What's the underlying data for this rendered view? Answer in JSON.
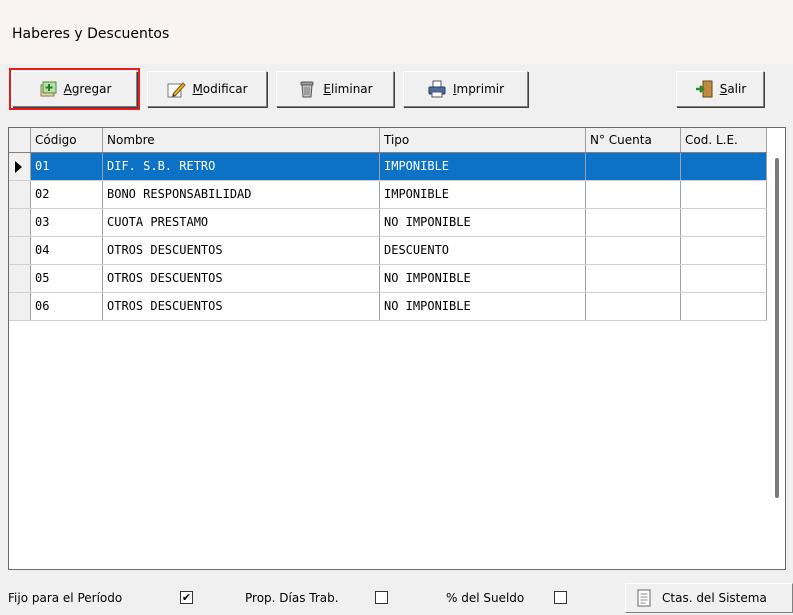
{
  "window": {
    "title": "Haberes y Descuentos"
  },
  "toolbar": {
    "agregar": {
      "pre": "",
      "key": "A",
      "rest": "gregar",
      "icon": "add-record-icon"
    },
    "modificar": {
      "pre": "",
      "key": "M",
      "rest": "odificar",
      "icon": "edit-pencil-icon"
    },
    "eliminar": {
      "pre": "",
      "key": "E",
      "rest": "liminar",
      "icon": "trash-can-icon"
    },
    "imprimir": {
      "pre": "",
      "key": "I",
      "rest": "mprimir",
      "icon": "printer-icon"
    },
    "salir": {
      "pre": "",
      "key": "S",
      "rest": "alir",
      "icon": "exit-door-icon"
    }
  },
  "grid": {
    "columns": [
      "Código",
      "Nombre",
      "Tipo",
      "N° Cuenta",
      "Cod. L.E."
    ],
    "rows": [
      {
        "codigo": "01",
        "nombre": "DIF. S.B. RETRO",
        "tipo": "IMPONIBLE",
        "cuenta": "",
        "codle": ""
      },
      {
        "codigo": "02",
        "nombre": "BONO RESPONSABILIDAD",
        "tipo": "IMPONIBLE",
        "cuenta": "",
        "codle": ""
      },
      {
        "codigo": "03",
        "nombre": "CUOTA PRESTAMO",
        "tipo": "NO IMPONIBLE",
        "cuenta": "",
        "codle": ""
      },
      {
        "codigo": "04",
        "nombre": "OTROS DESCUENTOS",
        "tipo": "DESCUENTO",
        "cuenta": "",
        "codle": ""
      },
      {
        "codigo": "05",
        "nombre": "OTROS DESCUENTOS",
        "tipo": "NO IMPONIBLE",
        "cuenta": "",
        "codle": ""
      },
      {
        "codigo": "06",
        "nombre": "OTROS DESCUENTOS",
        "tipo": "NO IMPONIBLE",
        "cuenta": "",
        "codle": ""
      }
    ]
  },
  "options": {
    "fijo": {
      "label": "Fijo para el Período",
      "checked": true
    },
    "prop": {
      "label": "Prop. Días Trab.",
      "checked": false
    },
    "sueldo": {
      "label": "% del Sueldo",
      "checked": false
    }
  },
  "ctas_button": {
    "label": "Ctas. del Sistema",
    "icon": "document-icon"
  },
  "colors": {
    "selection": "#0b72c7",
    "highlight_outline": "#e01e1e"
  }
}
